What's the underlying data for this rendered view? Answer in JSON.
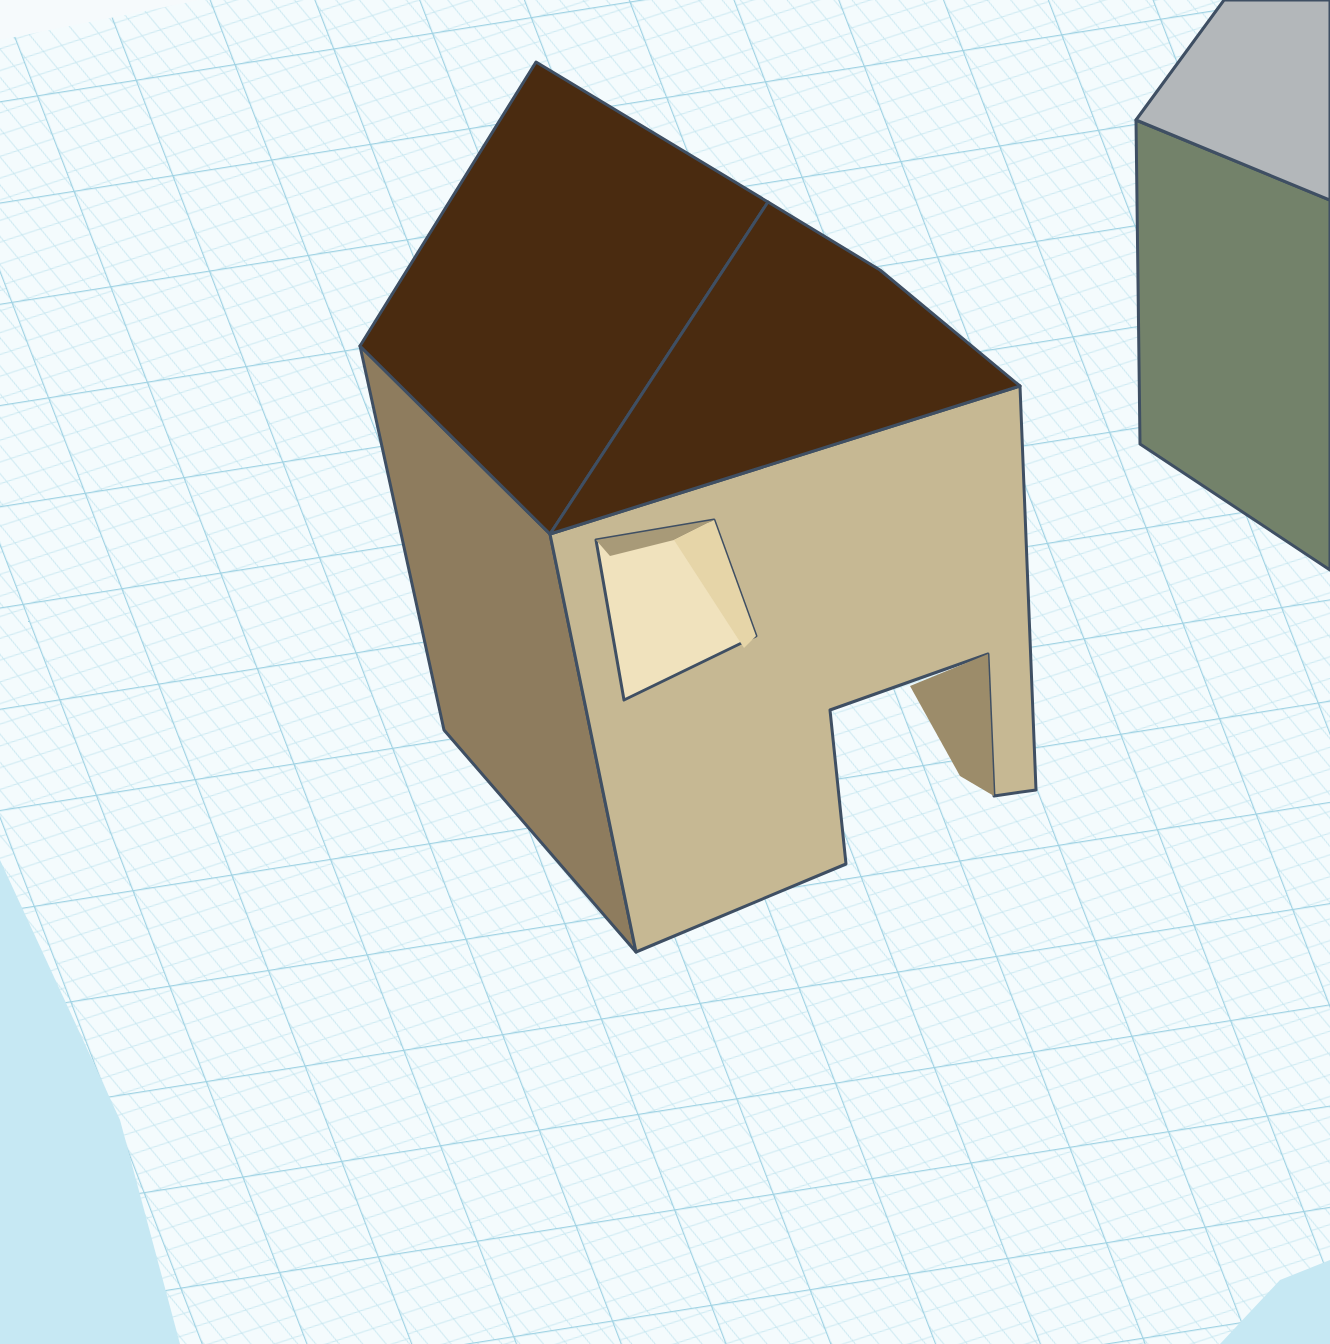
{
  "workplane": {
    "kind": "grid"
  },
  "objects": [
    {
      "kind": "house"
    },
    {
      "kind": "box"
    }
  ]
}
